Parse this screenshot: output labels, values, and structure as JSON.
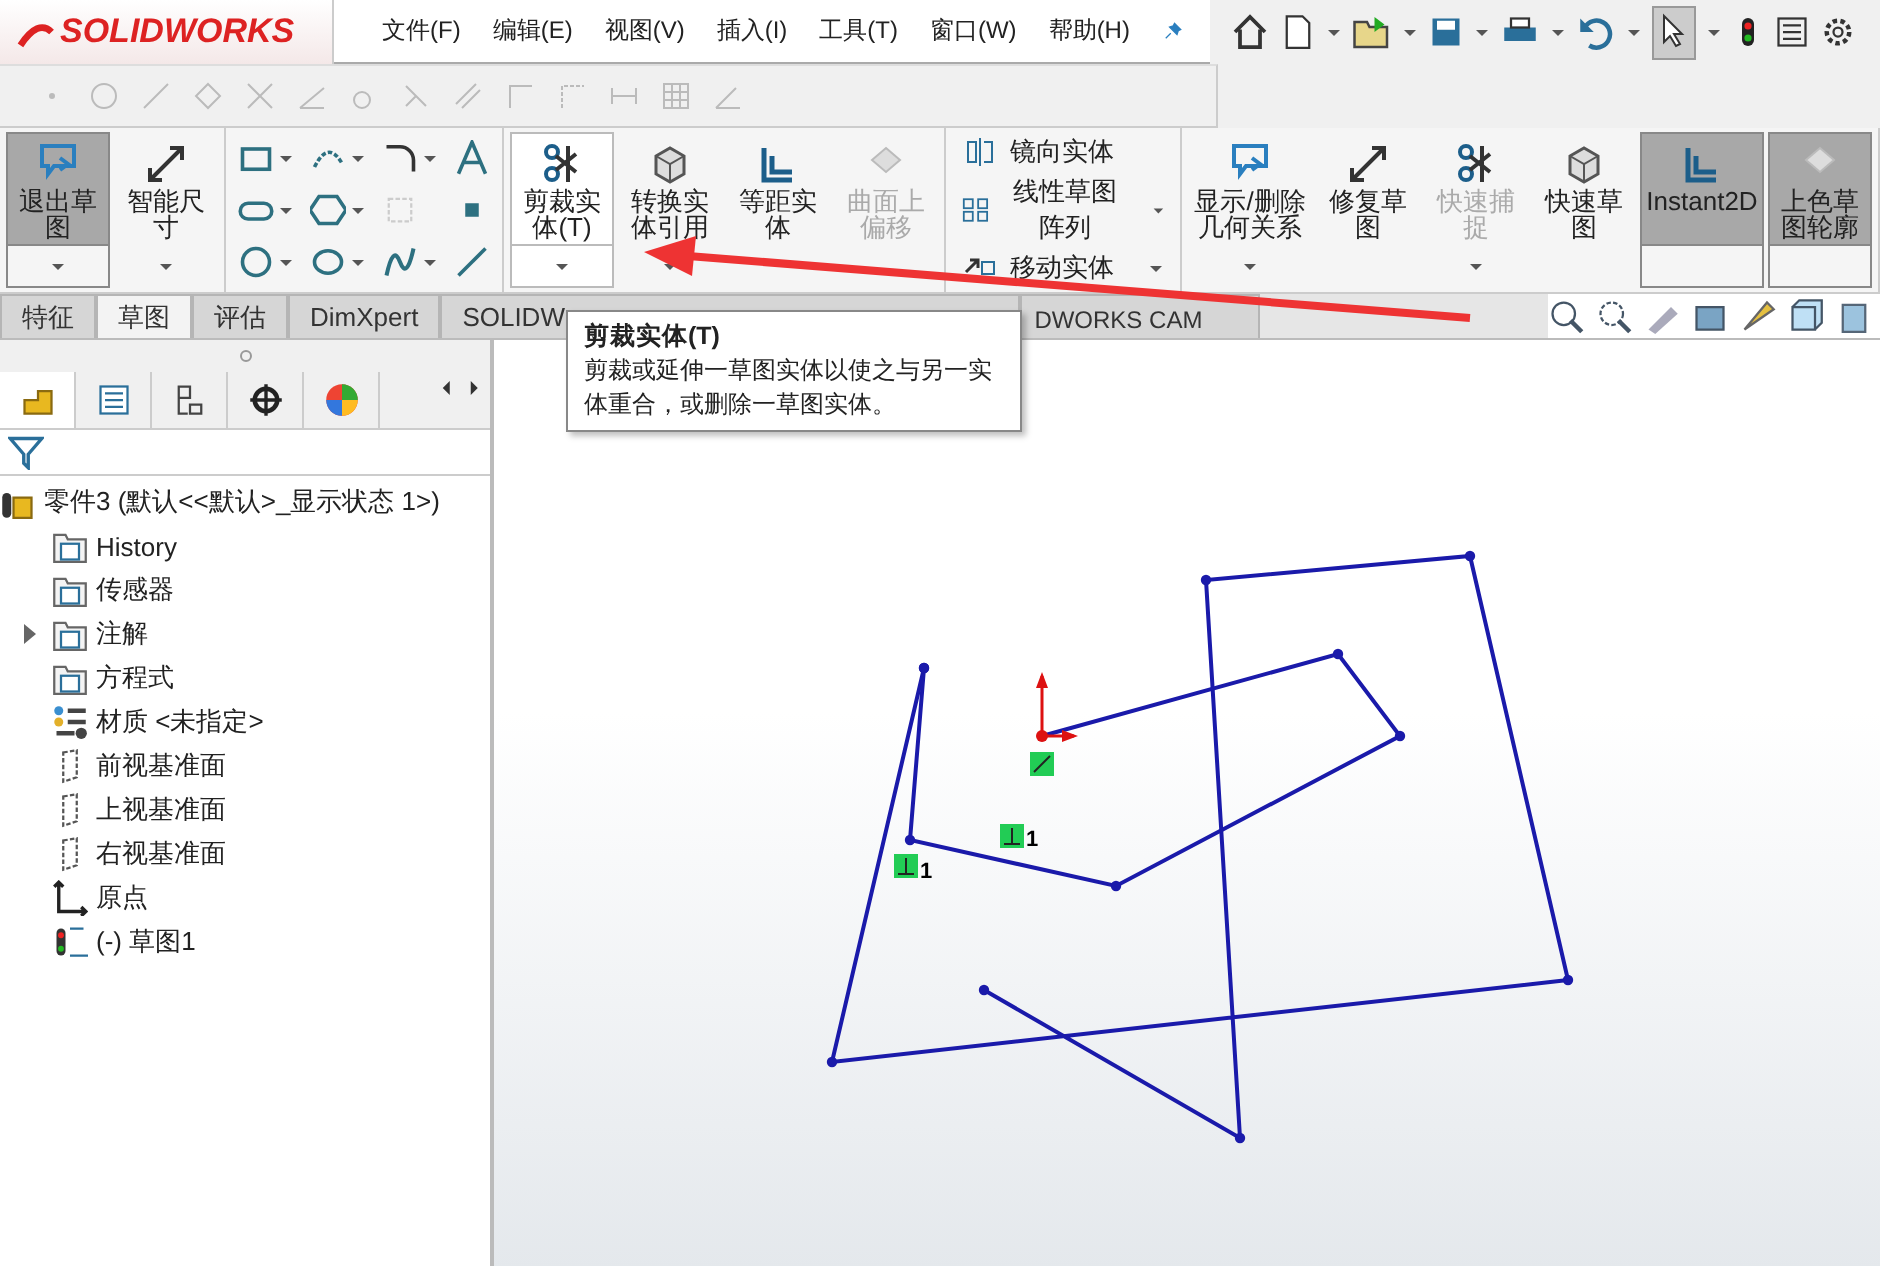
{
  "logo": "SOLIDWORKS",
  "menu": [
    "文件(F)",
    "编辑(E)",
    "视图(V)",
    "插入(I)",
    "工具(T)",
    "窗口(W)",
    "帮助(H)"
  ],
  "ribbon": {
    "left": [
      {
        "label": "退出草图",
        "pressed": true,
        "disabled": false,
        "hovered": false,
        "dropdown": true
      },
      {
        "label": "智能尺寸",
        "pressed": false,
        "disabled": false,
        "hovered": false,
        "dropdown": true
      }
    ],
    "center": [
      {
        "label": "剪裁实体(T)",
        "pressed": false,
        "disabled": false,
        "hovered": true,
        "dropdown": true
      },
      {
        "label": "转换实体引用",
        "pressed": false,
        "disabled": false,
        "hovered": false,
        "dropdown": true
      },
      {
        "label": "等距实体",
        "pressed": false,
        "disabled": false,
        "hovered": false,
        "dropdown": false
      },
      {
        "label": "曲面上偏移",
        "pressed": false,
        "disabled": true,
        "hovered": false,
        "dropdown": false
      }
    ],
    "list": [
      {
        "label": "镜向实体",
        "dropdown": false
      },
      {
        "label": "线性草图阵列",
        "dropdown": true
      },
      {
        "label": "移动实体",
        "dropdown": true
      }
    ],
    "right": [
      {
        "label": "显示/删除几何关系",
        "pressed": false,
        "disabled": false,
        "hovered": false,
        "dropdown": true
      },
      {
        "label": "修复草图",
        "pressed": false,
        "disabled": false,
        "hovered": false,
        "dropdown": false
      },
      {
        "label": "快速捕捉",
        "pressed": false,
        "disabled": true,
        "hovered": false,
        "dropdown": true
      },
      {
        "label": "快速草图",
        "pressed": false,
        "disabled": false,
        "hovered": false,
        "dropdown": false
      },
      {
        "label": "Instant2D",
        "pressed": true,
        "disabled": false,
        "hovered": false,
        "dropdown": false
      },
      {
        "label": "上色草图轮廓",
        "pressed": true,
        "disabled": false,
        "hovered": false,
        "dropdown": false
      }
    ]
  },
  "tabs": [
    {
      "label": "特征",
      "selected": false
    },
    {
      "label": "草图",
      "selected": true
    },
    {
      "label": "评估",
      "selected": false
    },
    {
      "label": "DimXpert",
      "selected": false
    },
    {
      "label": "SOLIDW",
      "selected": false
    },
    {
      "label": "DWORKS CAM",
      "selected": false
    }
  ],
  "tooltip": {
    "title": "剪裁实体(T)",
    "text": "剪裁或延伸一草图实体以使之与另一实体重合，或删除一草图实体。"
  },
  "tree": {
    "root": "零件3  (默认<<默认>_显示状态 1>)",
    "items": [
      {
        "kind": "history",
        "label": "History",
        "collapsed": false
      },
      {
        "kind": "sensor",
        "label": "传感器",
        "collapsed": false
      },
      {
        "kind": "annotation",
        "label": "注解",
        "collapsed": true
      },
      {
        "kind": "equation",
        "label": "方程式",
        "collapsed": false
      },
      {
        "kind": "material",
        "label": "材质 <未指定>",
        "collapsed": false
      },
      {
        "kind": "plane",
        "label": "前视基准面",
        "collapsed": false
      },
      {
        "kind": "plane",
        "label": "上视基准面",
        "collapsed": false
      },
      {
        "kind": "plane",
        "label": "右视基准面",
        "collapsed": false
      },
      {
        "kind": "origin",
        "label": "原点",
        "collapsed": false
      },
      {
        "kind": "sketch",
        "label": "(-) 草图1",
        "collapsed": false
      }
    ]
  },
  "canvas": {
    "relation_labels": [
      "1",
      "1"
    ]
  }
}
